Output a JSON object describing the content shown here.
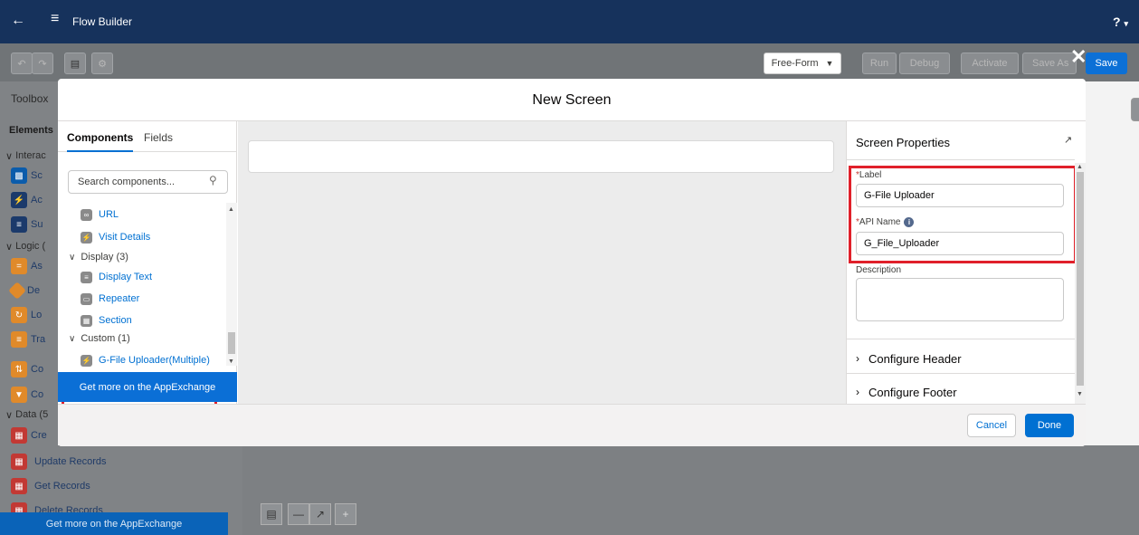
{
  "app": {
    "title": "Flow Builder",
    "help_label": "?"
  },
  "toolbar": {
    "canvas_mode": "Free-Form",
    "run": "Run",
    "debug": "Debug",
    "activate": "Activate",
    "save_as": "Save As",
    "save": "Save"
  },
  "toolbox": {
    "title": "Toolbox",
    "elements_tab": "Elements",
    "groups": [
      {
        "label": "Interac"
      },
      {
        "label": "Logic ("
      },
      {
        "label": "Data (5"
      }
    ],
    "items": [
      "Sc",
      "Ac",
      "Su",
      "As",
      "De",
      "Lo",
      "Tra",
      "Co",
      "Co",
      "Cre"
    ],
    "data_items": [
      "Update Records",
      "Get Records",
      "Delete Records"
    ],
    "appexchange": "Get more on the AppExchange"
  },
  "modal": {
    "title": "New Screen",
    "tabs": {
      "components": "Components",
      "fields": "Fields"
    },
    "search_placeholder": "Search components...",
    "components": {
      "url": "URL",
      "visit_details": "Visit Details",
      "display_group": "Display (3)",
      "display_text": "Display Text",
      "repeater": "Repeater",
      "section": "Section",
      "custom_group": "Custom (1)",
      "g_file_uploader": "G-File Uploader(Multiple)"
    },
    "appexchange": "Get more on the AppExchange",
    "properties": {
      "title": "Screen Properties",
      "label_field": "Label",
      "label_value": "G-File Uploader",
      "api_name_field": "API Name",
      "api_name_value": "G_File_Uploader",
      "description_field": "Description",
      "description_value": "",
      "configure_header": "Configure Header",
      "configure_footer": "Configure Footer"
    },
    "footer": {
      "cancel": "Cancel",
      "done": "Done"
    }
  },
  "colors": {
    "header_bg": "#16325c",
    "brand_blue": "#0070d2",
    "highlight_red": "#e0202a"
  }
}
